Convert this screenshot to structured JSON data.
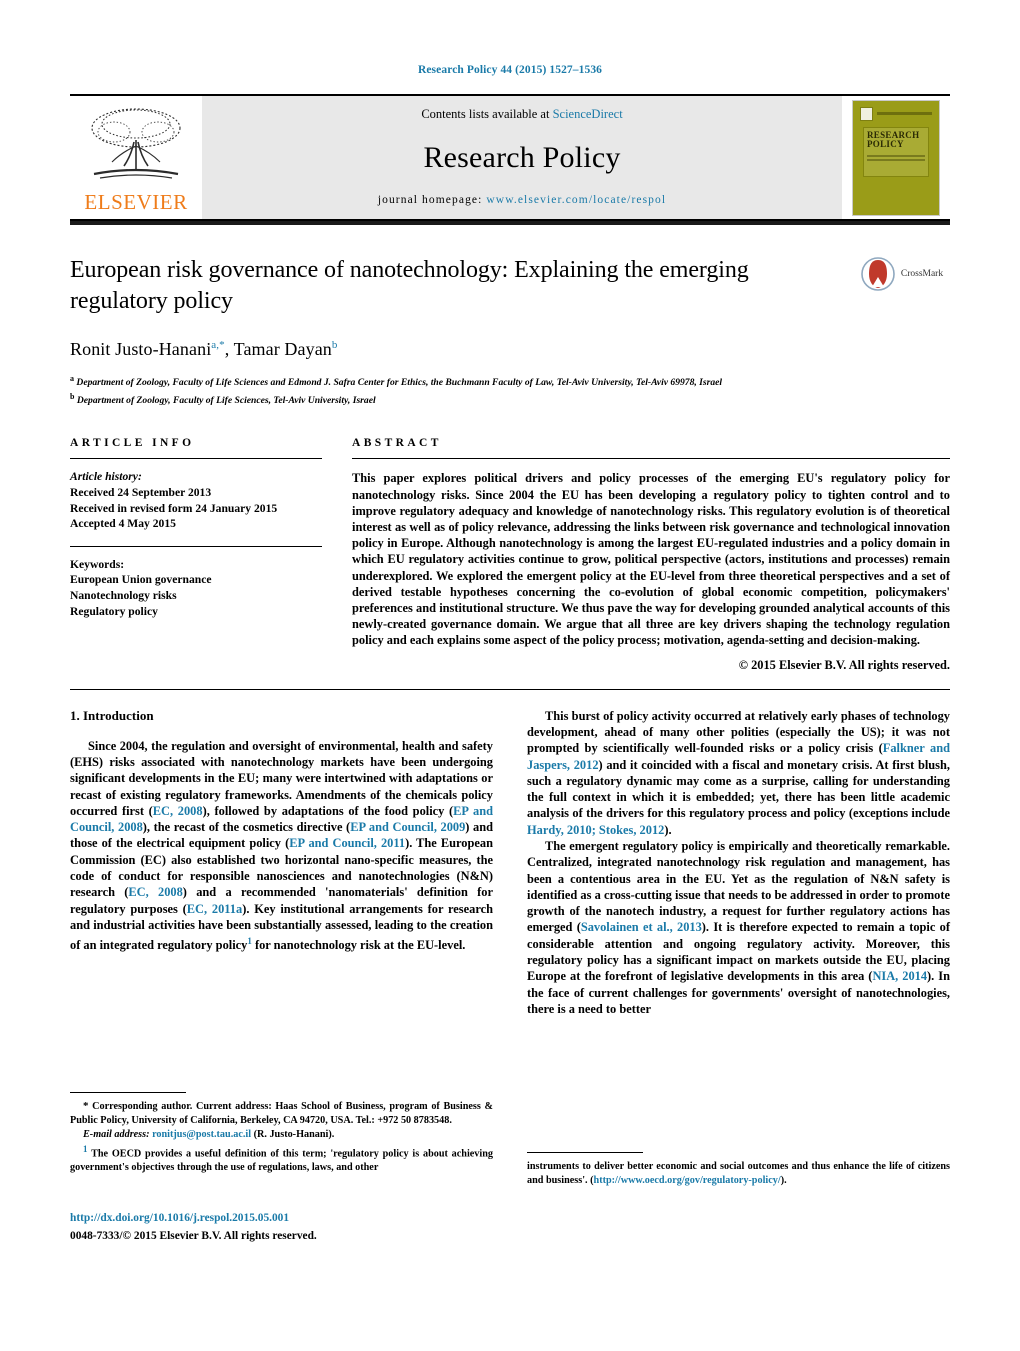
{
  "running_head": "Research Policy 44 (2015) 1527–1536",
  "masthead": {
    "contents_prefix": "Contents lists available at ",
    "sciencedirect": "ScienceDirect",
    "journal_name": "Research Policy",
    "homepage_prefix": "journal homepage: ",
    "homepage_url": "www.elsevier.com/locate/respol",
    "publisher": "ELSEVIER",
    "cover_title_line1": "RESEARCH",
    "cover_title_line2": "POLICY"
  },
  "article": {
    "title": "European risk governance of nanotechnology: Explaining the emerging regulatory policy",
    "crossmark_label": "CrossMark",
    "authors": [
      {
        "name": "Ronit Justo-Hanani",
        "marks": "a,*"
      },
      {
        "name": "Tamar Dayan",
        "marks": "b"
      }
    ],
    "affiliations": [
      {
        "mark": "a",
        "text": "Department of Zoology, Faculty of Life Sciences and Edmond J. Safra Center for Ethics, the Buchmann Faculty of Law, Tel-Aviv University, Tel-Aviv 69978, Israel"
      },
      {
        "mark": "b",
        "text": "Department of Zoology, Faculty of Life Sciences, Tel-Aviv University, Israel"
      }
    ]
  },
  "article_info": {
    "heading": "ARTICLE INFO",
    "history_label": "Article history:",
    "history": [
      "Received 24 September 2013",
      "Received in revised form 24 January 2015",
      "Accepted 4 May 2015"
    ],
    "keywords_label": "Keywords:",
    "keywords": [
      "European Union governance",
      "Nanotechnology risks",
      "Regulatory policy"
    ]
  },
  "abstract": {
    "heading": "ABSTRACT",
    "text": "This paper explores political drivers and policy processes of the emerging EU's regulatory policy for nanotechnology risks. Since 2004 the EU has been developing a regulatory policy to tighten control and to improve regulatory adequacy and knowledge of nanotechnology risks. This regulatory evolution is of theoretical interest as well as of policy relevance, addressing the links between risk governance and technological innovation policy in Europe. Although nanotechnology is among the largest EU-regulated industries and a policy domain in which EU regulatory activities continue to grow, political perspective (actors, institutions and processes) remain underexplored. We explored the emergent policy at the EU-level from three theoretical perspectives and a set of derived testable hypotheses concerning the co-evolution of global economic competition, policymakers' preferences and institutional structure. We thus pave the way for developing grounded analytical accounts of this newly-created governance domain. We argue that all three are key drivers shaping the technology regulation policy and each explains some aspect of the policy process; motivation, agenda-setting and decision-making.",
    "copyright": "© 2015 Elsevier B.V. All rights reserved."
  },
  "body": {
    "section_heading": "1. Introduction",
    "left_paragraph_1": {
      "part1": "Since 2004, the regulation and oversight of environmental, health and safety (EHS) risks associated with nanotechnology markets have been undergoing significant developments in the EU; many were intertwined with adaptations or recast of existing regulatory frameworks. Amendments of the chemicals policy occurred first (",
      "cit1": "EC, 2008",
      "part2": "), followed by adaptations of the food policy (",
      "cit2": "EP and Council, 2008",
      "part3": "), the recast of the cosmetics directive (",
      "cit3": "EP and Council, 2009",
      "part4": ") and those of the electrical equipment policy (",
      "cit4": "EP and Council, 2011",
      "part5": "). The European Commission (EC) also established two horizontal nano-specific measures, the code of conduct for responsible nanosciences and nanotechnologies (N&N) research (",
      "cit5": "EC, 2008",
      "part6": ") and a recommended 'nanomaterials' definition for regulatory purposes (",
      "cit6": "EC, 2011a",
      "part7": "). Key institutional arrangements for research and industrial activities have been substantially assessed, leading to the creation of an integrated regulatory policy",
      "footnote_marker": "1",
      "part8": " for nanotechnology risk at the EU-level."
    },
    "right_paragraph_1": {
      "part1": "This burst of policy activity occurred at relatively early phases of technology development, ahead of many other polities (especially the US); it was not prompted by scientifically well-founded risks or a policy crisis (",
      "cit1": "Falkner and Jaspers, 2012",
      "part2": ") and it coincided with a fiscal and monetary crisis. At first blush, such a regulatory dynamic may come as a surprise, calling for understanding the full context in which it is embedded; yet, there has been little academic analysis of the drivers for this regulatory process and policy (exceptions include ",
      "cit2": "Hardy, 2010; Stokes, 2012",
      "part3": ")."
    },
    "right_paragraph_2": {
      "part1": "The emergent regulatory policy is empirically and theoretically remarkable. Centralized, integrated nanotechnology risk regulation and management, has been a contentious area in the EU. Yet as the regulation of N&N safety is identified as a cross-cutting issue that needs to be addressed in order to promote growth of the nanotech industry, a request for further regulatory actions has emerged (",
      "cit1": "Savolainen et al., 2013",
      "part2": "). It is therefore expected to remain a topic of considerable attention and ongoing regulatory activity. Moreover, this regulatory policy has a significant impact on markets outside the EU, placing Europe at the forefront of legislative developments in this area (",
      "cit2": "NIA, 2014",
      "part3": "). In the face of current challenges for governments' oversight of nanotechnologies, there is a need to better"
    }
  },
  "footnotes": {
    "corresponding": {
      "star": "*",
      "text": " Corresponding author. Current address: Haas School of Business, program of Business & Public Policy, University of California, Berkeley, CA 94720, USA. Tel.: +972 50 8783548."
    },
    "email": {
      "label": "E-mail address:",
      "address": "ronitjus@post.tau.ac.il",
      "suffix": " (R. Justo-Hanani)."
    },
    "note1": {
      "marker": "1",
      "text": " The OECD provides a useful definition of this term; 'regulatory policy is about achieving government's objectives through the use of regulations, laws, and other"
    },
    "note1_cont": {
      "text": "instruments to deliver better economic and social outcomes and thus enhance the life of citizens and business'. (",
      "url": "http://www.oecd.org/gov/regulatory-policy/",
      "suffix": ")."
    },
    "doi": "http://dx.doi.org/10.1016/j.respol.2015.05.001",
    "issn": "0048-7333/© 2015 Elsevier B.V. All rights reserved."
  }
}
